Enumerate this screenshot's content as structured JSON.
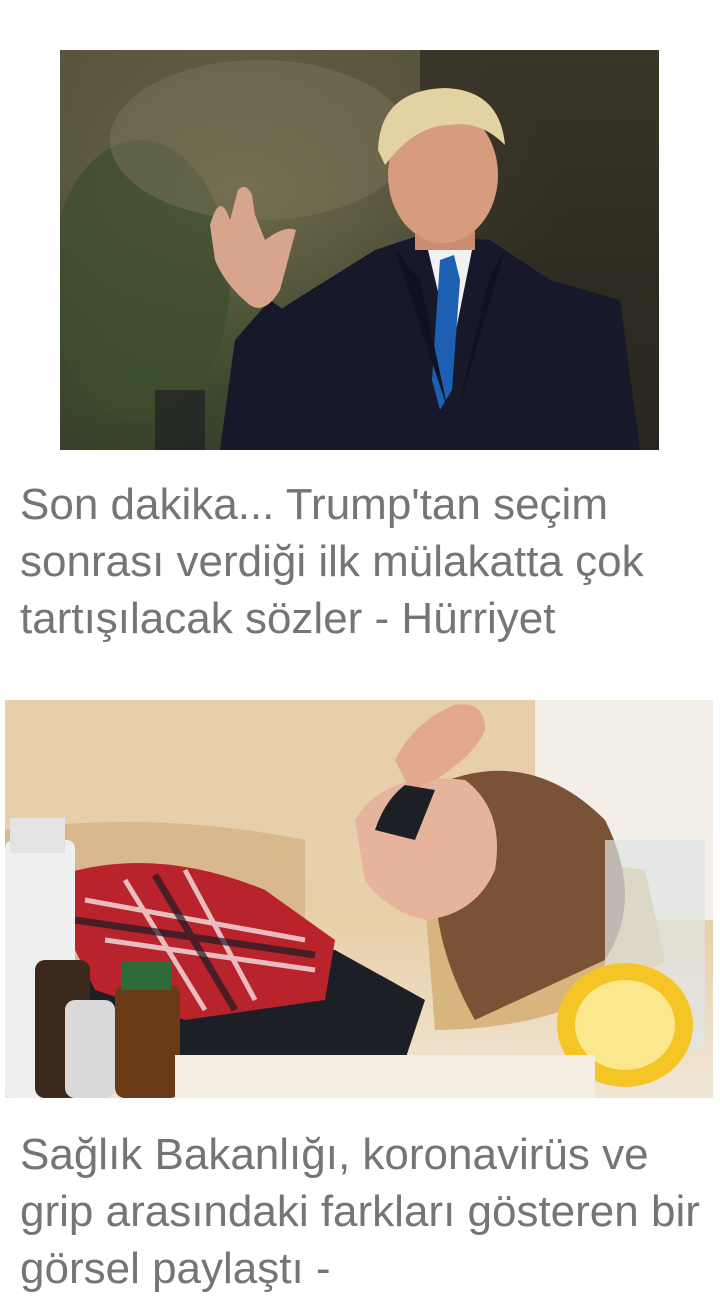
{
  "feed": {
    "articles": [
      {
        "title": "Son dakika... Trump'tan seçim sonrası verdiği ilk mülakatta çok tartışılacak sözler - Hürriyet",
        "image_subject": "man-waving-photo"
      },
      {
        "title": "Sağlık Bakanlığı, koronavirüs ve grip arasındaki farkları gösteren bir görsel paylaştı -",
        "image_subject": "sick-woman-resting-photo"
      }
    ]
  }
}
